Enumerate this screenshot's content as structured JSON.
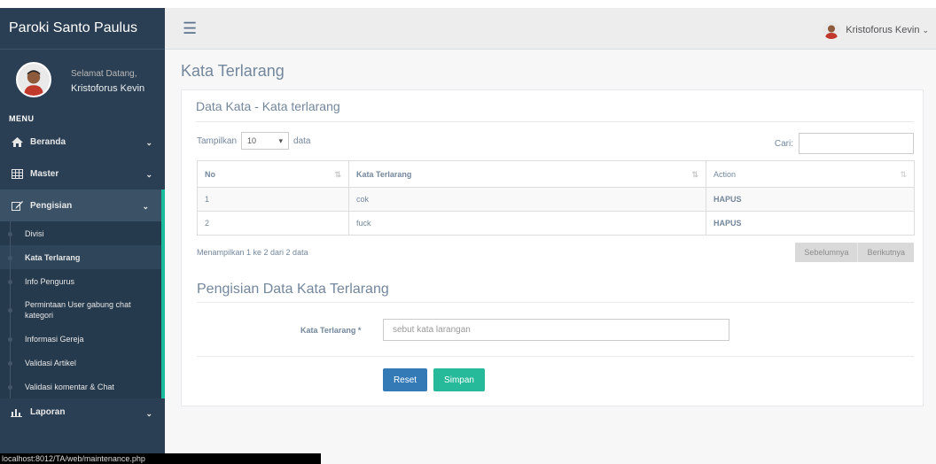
{
  "brand": "Paroki Santo Paulus",
  "profile": {
    "welcome": "Selamat Datang,",
    "name": "Kristoforus Kevin"
  },
  "menu_title": "MENU",
  "nav": {
    "beranda": "Beranda",
    "master": "Master",
    "pengisian": "Pengisian",
    "laporan": "Laporan"
  },
  "submenu": [
    "Divisi",
    "Kata Terlarang",
    "Info Pengurus",
    "Permintaan User gabung chat kategori",
    "Informasi Gereja",
    "Validasi Artikel",
    "Validasi komentar & Chat"
  ],
  "topnav": {
    "user": "Kristoforus Kevin"
  },
  "page_title": "Kata Terlarang",
  "panel_title": "Data Kata - Kata terlarang",
  "table_controls": {
    "show_label": "Tampilkan",
    "page_length": "10",
    "data_label": "data",
    "search_label": "Cari:"
  },
  "table": {
    "headers": [
      "No",
      "Kata Terlarang",
      "Action"
    ],
    "rows": [
      [
        "1",
        "cok",
        "HAPUS"
      ],
      [
        "2",
        "fuck",
        "HAPUS"
      ]
    ]
  },
  "info": "Menampilkan 1 ke 2 dari 2 data",
  "pagination": {
    "prev": "Sebelumnya",
    "next": "Berikutnya"
  },
  "form": {
    "title": "Pengisian Data Kata Terlarang",
    "label": "Kata Terlarang *",
    "placeholder": "sebut kata larangan",
    "reset": "Reset",
    "save": "Simpan"
  },
  "status_url": "localhost:8012/TA/web/maintenance.php",
  "colors": {
    "sidebar": "#2a3f54",
    "accent": "#1abb9c",
    "reset_button": "#337ab7",
    "save_button": "#26b99a"
  }
}
